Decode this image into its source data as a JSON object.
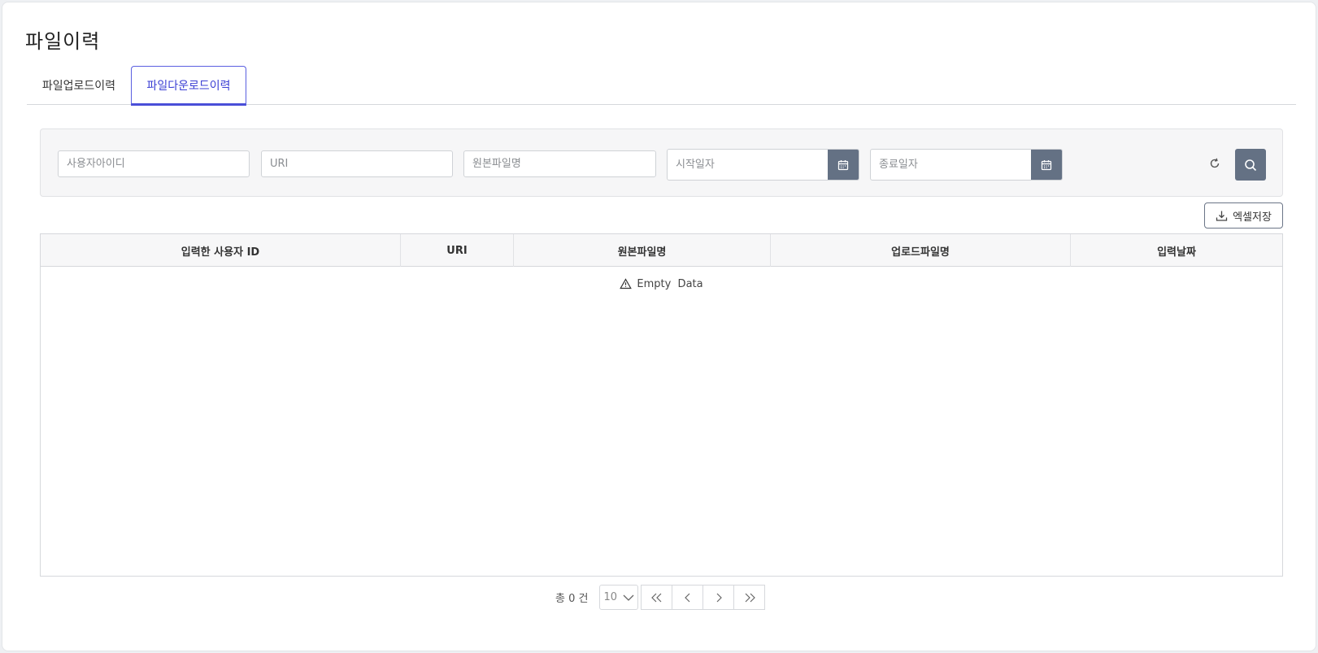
{
  "page": {
    "title": "파일이력"
  },
  "tabs": [
    {
      "label": "파일업로드이력",
      "active": false
    },
    {
      "label": "파일다운로드이력",
      "active": true
    }
  ],
  "search": {
    "user_id_placeholder": "사용자아이디",
    "uri_placeholder": "URI",
    "orig_file_placeholder": "원본파일명",
    "start_date_placeholder": "시작일자",
    "end_date_placeholder": "종료일자"
  },
  "toolbar": {
    "excel_label": "엑셀저장"
  },
  "table": {
    "columns": [
      "입력한 사용자 ID",
      "URI",
      "원본파일명",
      "업로드파일명",
      "입력날짜"
    ],
    "rows": [],
    "empty_text": "Empty  Data"
  },
  "pagination": {
    "total_text": "총 0 건",
    "page_size": "10"
  },
  "colors": {
    "accent": "#4a4fd8",
    "button_dark": "#647184"
  }
}
